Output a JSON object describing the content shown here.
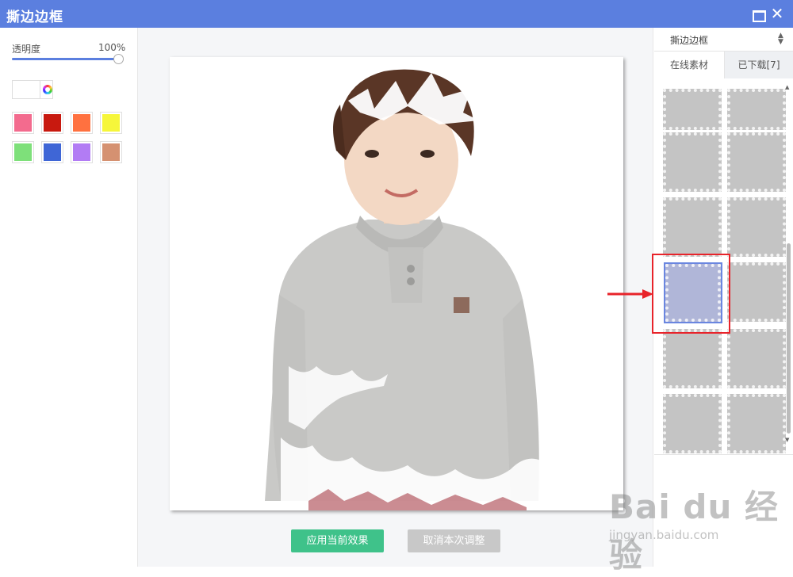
{
  "window": {
    "title": "撕边边框",
    "max_icon": "maximize-icon",
    "close_icon": "close-icon",
    "close_glyph": "✕"
  },
  "left_panel": {
    "opacity_label": "透明度",
    "opacity_value": "100%",
    "opacity_percent": 100,
    "swatches": [
      "#f36b8e",
      "#c8190f",
      "#ff7140",
      "#f6f63a",
      "#7ee07a",
      "#3f66d6",
      "#b27cf4",
      "#d59171"
    ]
  },
  "center_panel": {
    "apply_button": "应用当前效果",
    "cancel_button": "取消本次调整"
  },
  "right_panel": {
    "category": "撕边边框",
    "tabs": [
      "在线素材",
      "已下载[7]"
    ],
    "active_tab": 0,
    "selected_thumbnail": 6,
    "thumbnail_count": 12
  },
  "watermark": {
    "main": "Bai du 经验",
    "sub": "jingyan.baidu.com"
  },
  "colors": {
    "titlebar": "#5b7fdf",
    "apply": "#3fc28a",
    "cancel": "#c8c8c8",
    "highlight": "#e8232a"
  }
}
